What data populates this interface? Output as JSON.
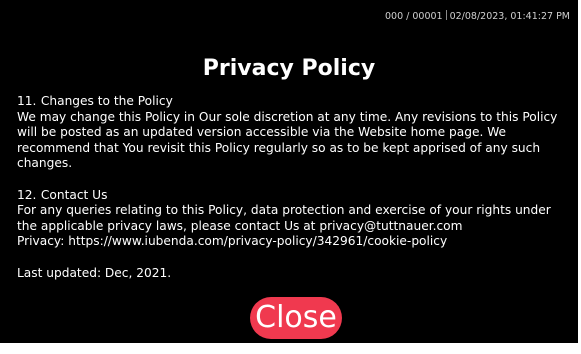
{
  "status": {
    "id": "000 / 00001",
    "datetime": "02/08/2023, 01:41:27 PM"
  },
  "title": "Privacy Policy",
  "sections": [
    {
      "number": "11.",
      "heading": "Changes to the Policy",
      "lines": [
        "We may change this Policy in Our sole discretion at any time. Any revisions to this Policy",
        "will be posted as an updated version accessible via the Website home page. We",
        "recommend that You revisit this Policy regularly so as to be kept apprised of any such",
        "changes."
      ]
    },
    {
      "number": "12.",
      "heading": "Contact Us",
      "lines": [
        "For any queries relating to this Policy, data protection and exercise of your rights under",
        "the applicable privacy laws, please contact Us at privacy@tuttnauer.com",
        "Privacy:  https://www.iubenda.com/privacy-policy/342961/cookie-policy"
      ]
    }
  ],
  "last_updated": "Last updated: Dec, 2021.",
  "close_label": "Close",
  "colors": {
    "background": "#000000",
    "accent": "#f0394f",
    "text": "#ffffff"
  }
}
